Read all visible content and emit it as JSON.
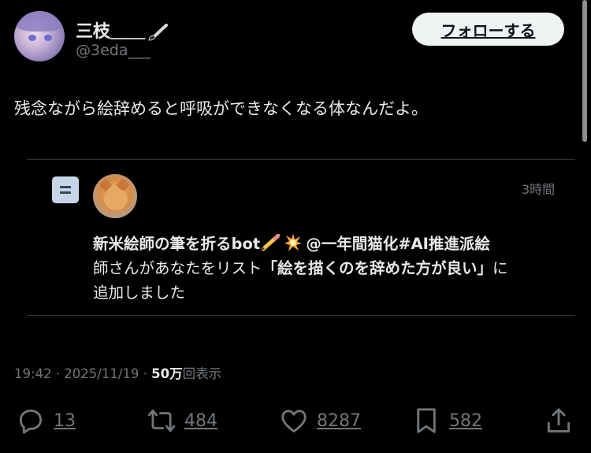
{
  "author": {
    "display_name": "三枝＿＿",
    "handle": "@3eda___"
  },
  "follow_label": "フォローする",
  "tweet_text": "残念ながら絵辞めると呼吸ができなくなる体なんだよ。",
  "quoted": {
    "time_ago": "3時間",
    "bot_name": "新米絵師の筆を折るbot",
    "mention": "@一年間猫化#AI推進派絵",
    "line2_prefix": "師さんがあなたをリスト",
    "list_name": "「絵を描くのを辞めた方が良い」",
    "line2_suffix": "に",
    "line3": "追加しました"
  },
  "meta": {
    "timestamp": "19:42 · 2025/11/19 · ",
    "views_value": "50万",
    "views_label": "回表示"
  },
  "actions": {
    "reply_count": "13",
    "retweet_count": "484",
    "like_count": "8287",
    "bookmark_count": "582"
  },
  "icons": {
    "reply": "reply-icon",
    "retweet": "retweet-icon",
    "like": "heart-icon",
    "bookmark": "bookmark-icon",
    "share": "share-icon"
  }
}
